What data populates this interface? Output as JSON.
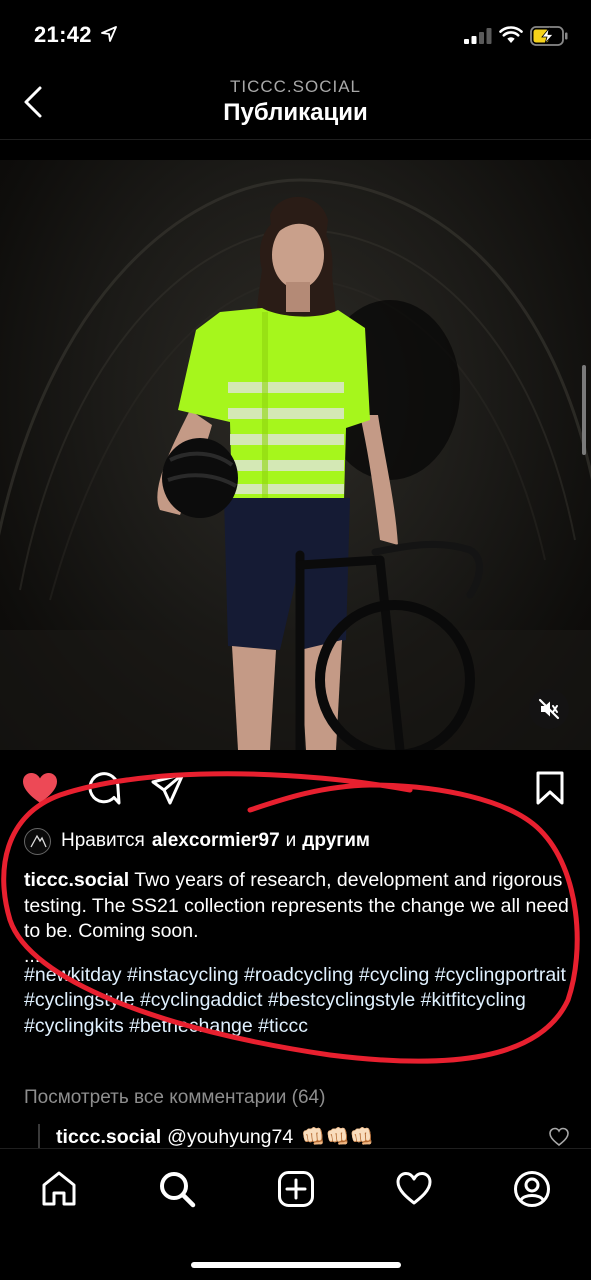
{
  "status_bar": {
    "time": "21:42"
  },
  "header": {
    "account": "TICCC.SOCIAL",
    "title": "Публикации"
  },
  "post": {
    "likes": {
      "prefix": "Нравится",
      "user": "alexcormier97",
      "suffix": "и",
      "others": "другим"
    },
    "caption": {
      "username": "ticcc.social",
      "text": "Two years of research, development and rigorous testing. The SS21 collection represents the change we all need to be. Coming soon.",
      "dots": "...",
      "hashtags": "#newkitday #instacycling #roadcycling #cycling #cyclingportrait #cyclingstyle #cyclingaddict #bestcyclingstyle #kitfitcycling #cyclingkits #bethechange #ticcc"
    },
    "view_comments": "Посмотреть все комментарии (64)",
    "reply": {
      "username": "ticcc.social",
      "text": "@youhyung74",
      "emoji": "👊🏻👊🏻👊🏻"
    }
  },
  "colors": {
    "like_red": "#ed4956",
    "annotation_red": "#e8202f",
    "jersey_green": "#a6f61c"
  },
  "icons": [
    "location-arrow-icon",
    "signal-icon",
    "wifi-icon",
    "battery-charging-icon",
    "back-chevron-icon",
    "mute-icon",
    "heart-filled-icon",
    "comment-icon",
    "share-icon",
    "bookmark-icon",
    "home-icon",
    "search-icon",
    "add-post-icon",
    "activity-heart-icon",
    "profile-icon"
  ]
}
